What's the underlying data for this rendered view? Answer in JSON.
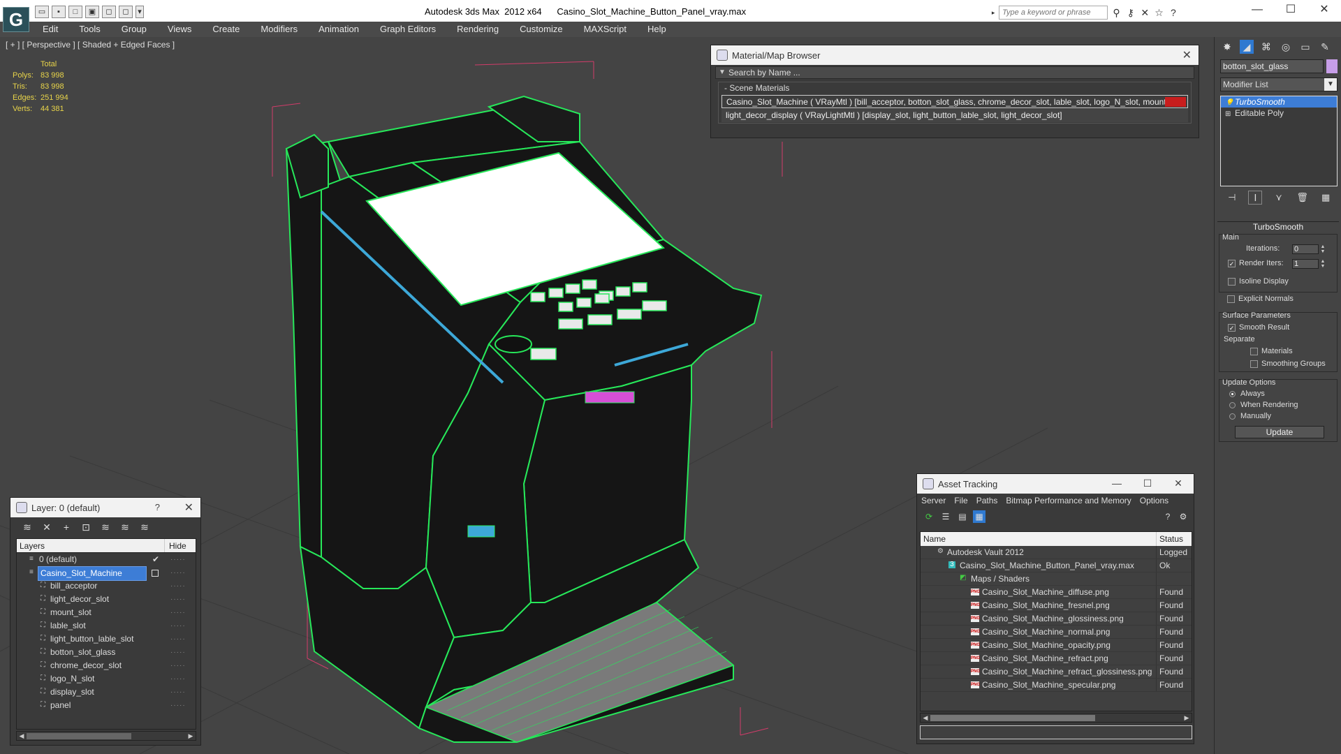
{
  "titlebar": {
    "app_title": "Autodesk 3ds Max  2012 x64      Casino_Slot_Machine_Button_Panel_vray.max",
    "search_placeholder": "Type a keyword or phrase",
    "logo_glyph": "G"
  },
  "menubar": {
    "items": [
      "Edit",
      "Tools",
      "Group",
      "Views",
      "Create",
      "Modifiers",
      "Animation",
      "Graph Editors",
      "Rendering",
      "Customize",
      "MAXScript",
      "Help"
    ]
  },
  "viewport": {
    "label": "[ + ] [ Perspective ] [ Shaded + Edged Faces ]",
    "stats": {
      "header": "Total",
      "polys_label": "Polys:",
      "polys": "83 998",
      "tris_label": "Tris:",
      "tris": "83 998",
      "edges_label": "Edges:",
      "edges": "251 994",
      "verts_label": "Verts:",
      "verts": "44 381"
    },
    "axis_label": "y",
    "wire_color": "#27e85a"
  },
  "material_browser": {
    "title": "Material/Map Browser",
    "search_text": "Search by Name ...",
    "group_header": "- Scene Materials",
    "materials": [
      "Casino_Slot_Machine ( VRayMtl ) [bill_acceptor, botton_slot_glass, chrome_decor_slot, lable_slot, logo_N_slot, mount_slot]",
      "light_decor_display ( VRayLightMtl ) [display_slot, light_button_lable_slot, light_decor_slot]"
    ],
    "swatch_color": "#c81d1d"
  },
  "command_panel": {
    "object_name": "botton_slot_glass",
    "object_color": "#c79ee8",
    "modifier_list_label": "Modifier List",
    "stack": [
      "TurboSmooth",
      "Editable Poly"
    ],
    "rollout_title": "TurboSmooth",
    "main_label": "Main",
    "iterations_label": "Iterations:",
    "iterations_value": "0",
    "render_iters_label": "Render Iters:",
    "render_iters_value": "1",
    "isoline_label": "Isoline Display",
    "explicit_normals_label": "Explicit Normals",
    "surface_params_label": "Surface Parameters",
    "smooth_result_label": "Smooth Result",
    "separate_label": "Separate",
    "materials_label": "Materials",
    "smoothing_groups_label": "Smoothing Groups",
    "update_options_label": "Update Options",
    "always_label": "Always",
    "when_rendering_label": "When Rendering",
    "manually_label": "Manually",
    "update_button": "Update"
  },
  "layer_panel": {
    "title": "Layer: 0 (default)",
    "help": "?",
    "col_layers": "Layers",
    "col_hide": "Hide",
    "layers": [
      {
        "name": "0 (default)",
        "level": 0
      },
      {
        "name": "Casino_Slot_Machine",
        "level": 0
      },
      {
        "name": "bill_acceptor",
        "level": 1
      },
      {
        "name": "light_decor_slot",
        "level": 1
      },
      {
        "name": "mount_slot",
        "level": 1
      },
      {
        "name": "lable_slot",
        "level": 1
      },
      {
        "name": "light_button_lable_slot",
        "level": 1
      },
      {
        "name": "botton_slot_glass",
        "level": 1
      },
      {
        "name": "chrome_decor_slot",
        "level": 1
      },
      {
        "name": "logo_N_slot",
        "level": 1
      },
      {
        "name": "display_slot",
        "level": 1
      },
      {
        "name": "panel",
        "level": 1
      }
    ]
  },
  "asset_tracking": {
    "title": "Asset Tracking",
    "menu": [
      "Server",
      "File",
      "Paths",
      "Bitmap Performance and Memory",
      "Options"
    ],
    "col_name": "Name",
    "col_status": "Status",
    "rows": [
      {
        "name": "Autodesk Vault 2012",
        "status": "Logged",
        "indent": 1,
        "icon": "vault"
      },
      {
        "name": "Casino_Slot_Machine_Button_Panel_vray.max",
        "status": "Ok",
        "indent": 2,
        "icon": "max"
      },
      {
        "name": "Maps / Shaders",
        "status": "",
        "indent": 3,
        "icon": "maps"
      },
      {
        "name": "Casino_Slot_Machine_diffuse.png",
        "status": "Found",
        "indent": 4,
        "icon": "png"
      },
      {
        "name": "Casino_Slot_Machine_fresnel.png",
        "status": "Found",
        "indent": 4,
        "icon": "png"
      },
      {
        "name": "Casino_Slot_Machine_glossiness.png",
        "status": "Found",
        "indent": 4,
        "icon": "png"
      },
      {
        "name": "Casino_Slot_Machine_normal.png",
        "status": "Found",
        "indent": 4,
        "icon": "png"
      },
      {
        "name": "Casino_Slot_Machine_opacity.png",
        "status": "Found",
        "indent": 4,
        "icon": "png"
      },
      {
        "name": "Casino_Slot_Machine_refract.png",
        "status": "Found",
        "indent": 4,
        "icon": "png"
      },
      {
        "name": "Casino_Slot_Machine_refract_glossiness.png",
        "status": "Found",
        "indent": 4,
        "icon": "png"
      },
      {
        "name": "Casino_Slot_Machine_specular.png",
        "status": "Found",
        "indent": 4,
        "icon": "png"
      }
    ]
  }
}
